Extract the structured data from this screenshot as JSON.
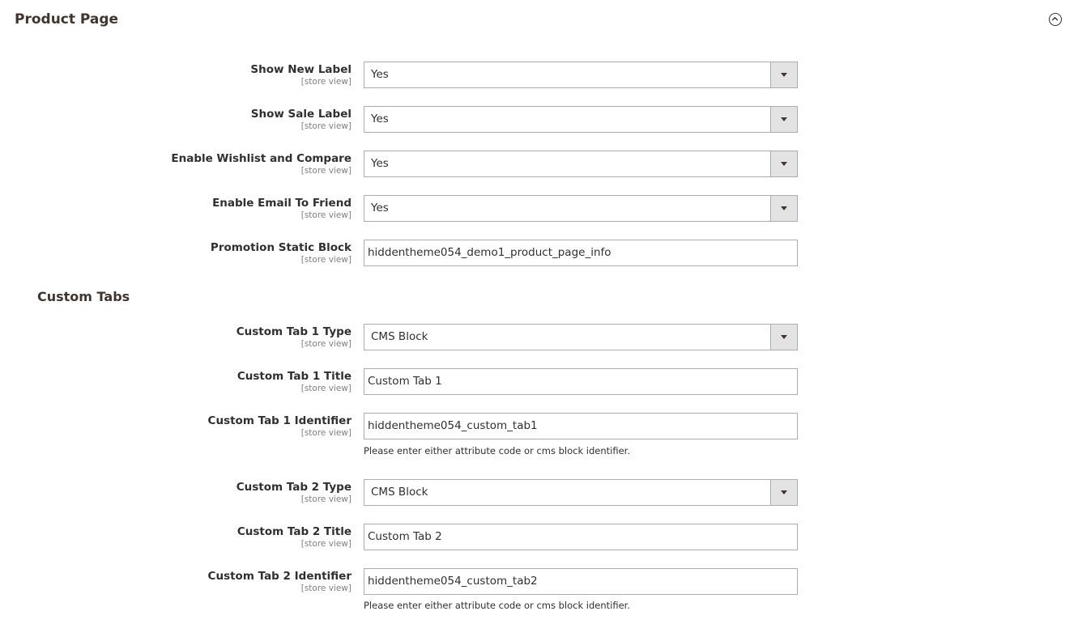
{
  "section": {
    "title": "Product Page",
    "collapse_icon": "chevron-up-circle-icon"
  },
  "subsection": {
    "title": "Custom Tabs"
  },
  "scope_label": "[store view]",
  "fields": {
    "show_new_label": {
      "label": "Show New Label",
      "value": "Yes"
    },
    "show_sale_label": {
      "label": "Show Sale Label",
      "value": "Yes"
    },
    "enable_wishlist_compare": {
      "label": "Enable Wishlist and Compare",
      "value": "Yes"
    },
    "enable_email_to_friend": {
      "label": "Enable Email To Friend",
      "value": "Yes"
    },
    "promotion_static_block": {
      "label": "Promotion Static Block",
      "value": "hiddentheme054_demo1_product_page_info"
    },
    "custom_tab_1_type": {
      "label": "Custom Tab 1 Type",
      "value": "CMS Block"
    },
    "custom_tab_1_title": {
      "label": "Custom Tab 1 Title",
      "value": "Custom Tab 1"
    },
    "custom_tab_1_identifier": {
      "label": "Custom Tab 1 Identifier",
      "value": "hiddentheme054_custom_tab1",
      "note": "Please enter either attribute code or cms block identifier."
    },
    "custom_tab_2_type": {
      "label": "Custom Tab 2 Type",
      "value": "CMS Block"
    },
    "custom_tab_2_title": {
      "label": "Custom Tab 2 Title",
      "value": "Custom Tab 2"
    },
    "custom_tab_2_identifier": {
      "label": "Custom Tab 2 Identifier",
      "value": "hiddentheme054_custom_tab2",
      "note": "Please enter either attribute code or cms block identifier."
    }
  }
}
